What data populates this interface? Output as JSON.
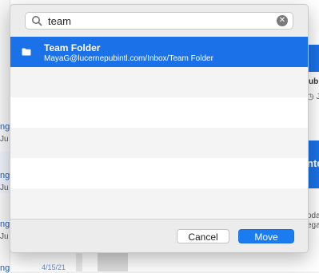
{
  "background": {
    "fragments": {
      "left_ng_1": "ng",
      "left_ju_1": "Ju",
      "left_ng_2": "ng",
      "left_ju_2": "Ju",
      "left_ng_3": "ng",
      "left_ju_3": "Ju",
      "left_ng_4": "ng",
      "date": "4/15/21",
      "right_ub": "ub",
      "right_j": "◷ J",
      "right_nte": "nte",
      "right_oda": "oda",
      "right_ega": "ega"
    }
  },
  "dialog": {
    "search": {
      "value": "team",
      "icon": "search-icon",
      "clear_icon": "clear-icon"
    },
    "results": [
      {
        "title": "Team Folder",
        "path": "MayaG@lucernepubintl.com/Inbox/Team Folder",
        "icon": "folder-icon",
        "selected": true
      }
    ],
    "buttons": {
      "cancel": "Cancel",
      "move": "Move"
    }
  },
  "colors": {
    "accent": "#1b72e8",
    "button_primary": "#1b7cf2"
  }
}
